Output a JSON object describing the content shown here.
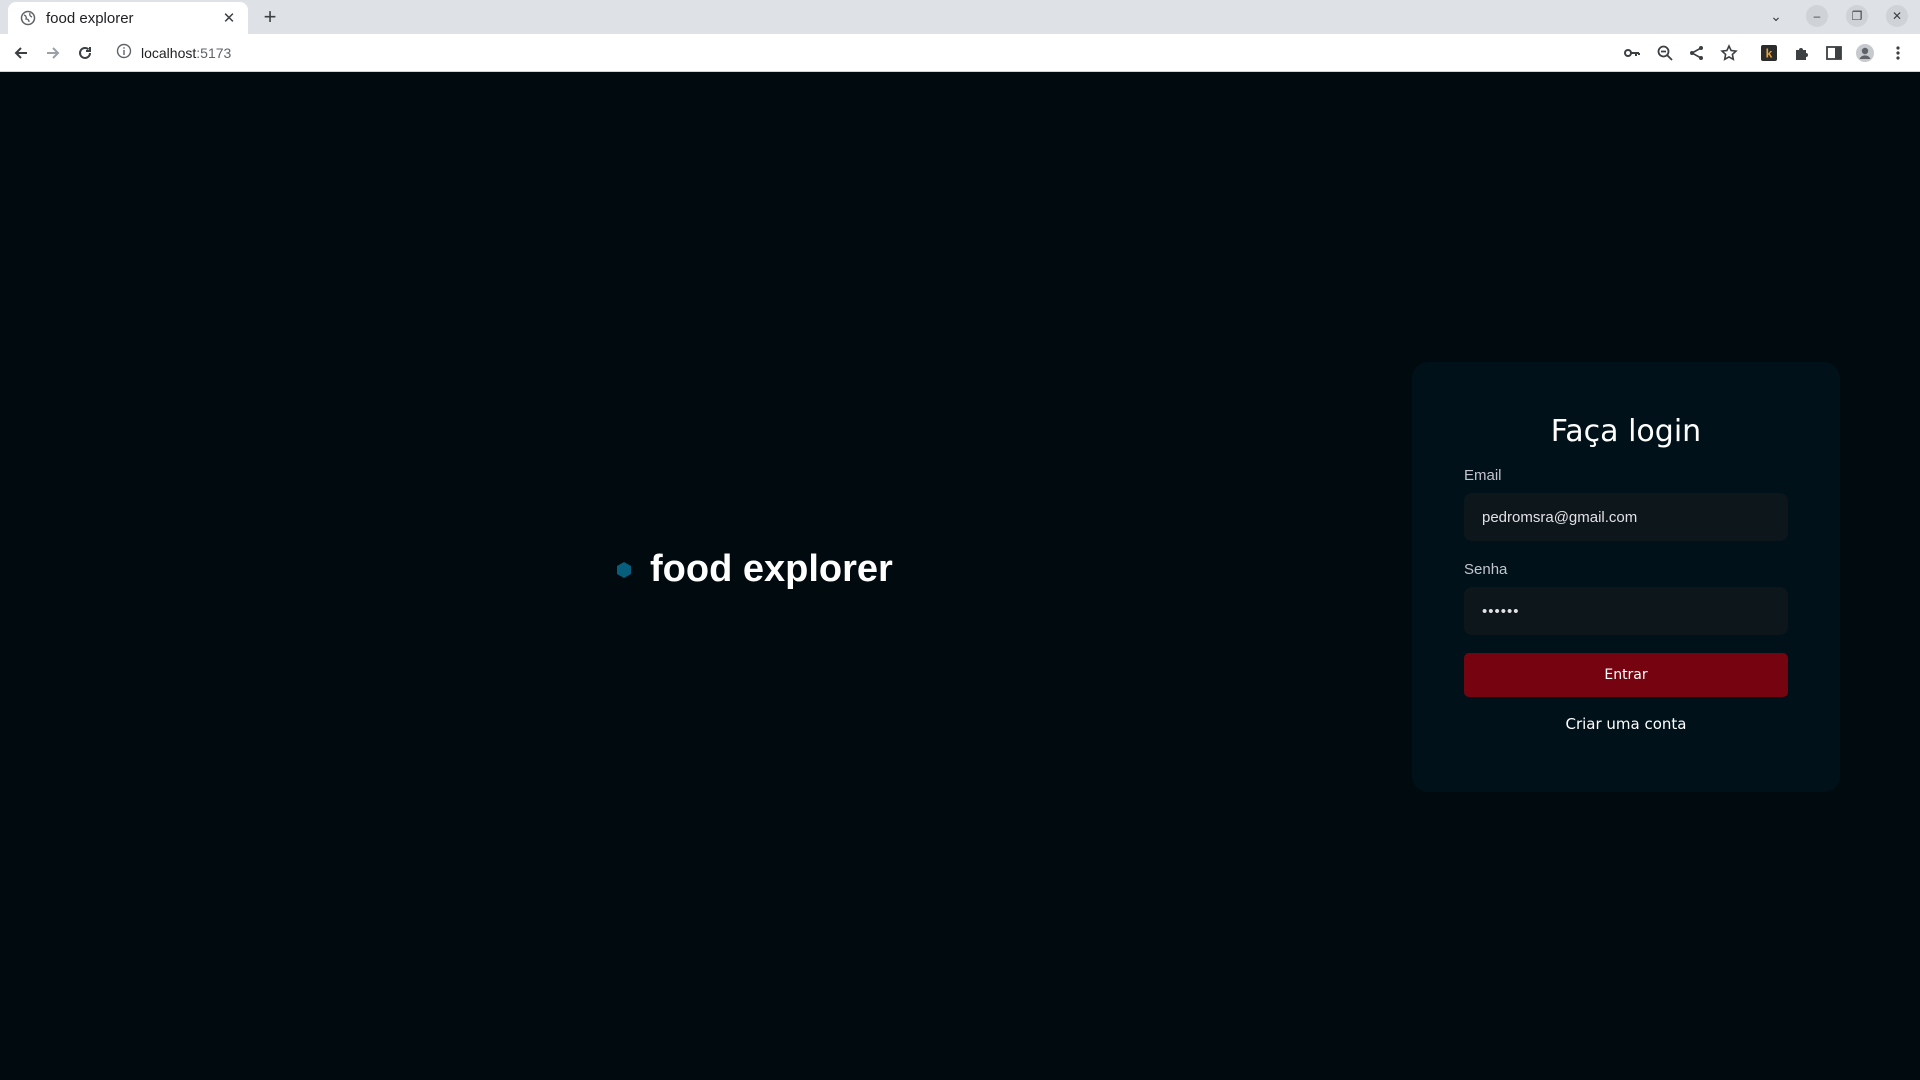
{
  "browser": {
    "tab": {
      "title": "food explorer",
      "favicon": "globe-icon",
      "close": "✕"
    },
    "new_tab": "+",
    "tab_search": "⌄",
    "window_controls": {
      "minimize": "–",
      "maximize": "❐",
      "close": "✕"
    },
    "address": {
      "host": "localhost",
      "port": ":5173",
      "info_icon": "info-icon"
    },
    "toolbar_icons": [
      "key-icon",
      "zoom-icon",
      "share-icon",
      "star-icon",
      "extension-k-icon",
      "puzzle-icon",
      "sidepanel-icon",
      "profile-icon",
      "menu-icon"
    ]
  },
  "brand": {
    "name": "food explorer",
    "logo": "hexagon-icon",
    "logo_color": "#065E7C"
  },
  "login": {
    "title": "Faça login",
    "email_label": "Email",
    "email_value": "pedromsra@gmail.com",
    "password_label": "Senha",
    "password_value": "••••••",
    "submit_label": "Entrar",
    "create_account_label": "Criar uma conta"
  },
  "colors": {
    "background": "#000A0F",
    "card": "#001119",
    "input": "#0D161B",
    "button": "#750310",
    "text": "#FFFFFF"
  }
}
